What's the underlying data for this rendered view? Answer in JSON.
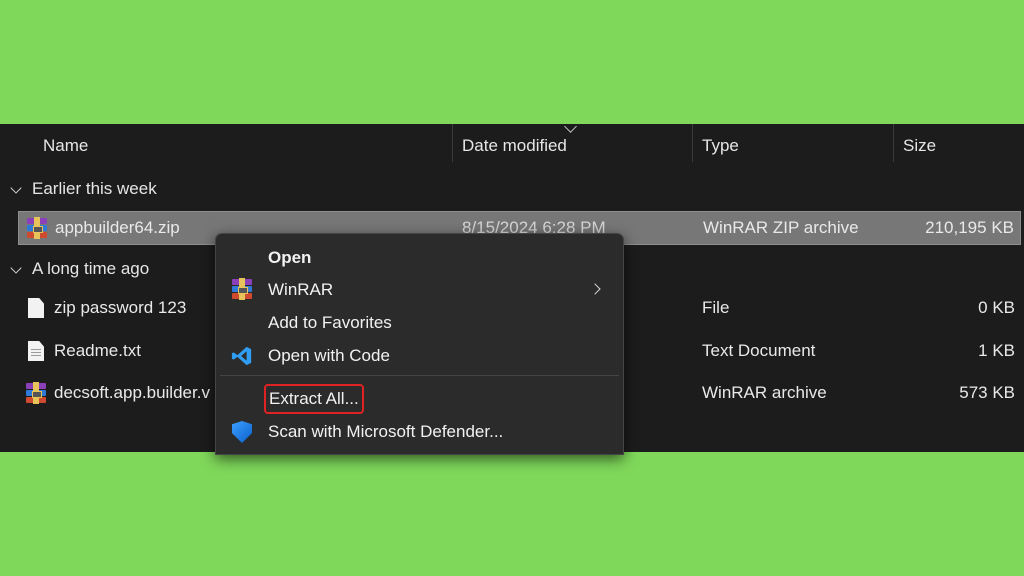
{
  "columns": {
    "name": "Name",
    "date": "Date modified",
    "type": "Type",
    "size": "Size"
  },
  "groups": {
    "recent": "Earlier this week",
    "old": "A long time ago"
  },
  "files": [
    {
      "name": "appbuilder64.zip",
      "date": "8/15/2024 6:28 PM",
      "type": "WinRAR ZIP archive",
      "size": "210,195 KB",
      "icon": "winrar-icon"
    },
    {
      "name": "zip password 123",
      "date": "",
      "type": "File",
      "size": "0 KB",
      "icon": "file-icon"
    },
    {
      "name": "Readme.txt",
      "date": "",
      "type": "Text Document",
      "size": "1 KB",
      "icon": "text-file-icon"
    },
    {
      "name": "decsoft.app.builder.v",
      "date": "",
      "type": "WinRAR archive",
      "size": "573 KB",
      "icon": "winrar-icon"
    }
  ],
  "context_menu": {
    "open": "Open",
    "winrar": "WinRAR",
    "favorites": "Add to Favorites",
    "open_code": "Open with Code",
    "extract_all": "Extract All...",
    "scan": "Scan with Microsoft Defender..."
  },
  "colors": {
    "background": "#7fd85a",
    "explorer_bg": "#1c1c1c",
    "menu_bg": "#2b2b2b",
    "highlight_box": "#e02222",
    "selected_row": "#777777"
  }
}
